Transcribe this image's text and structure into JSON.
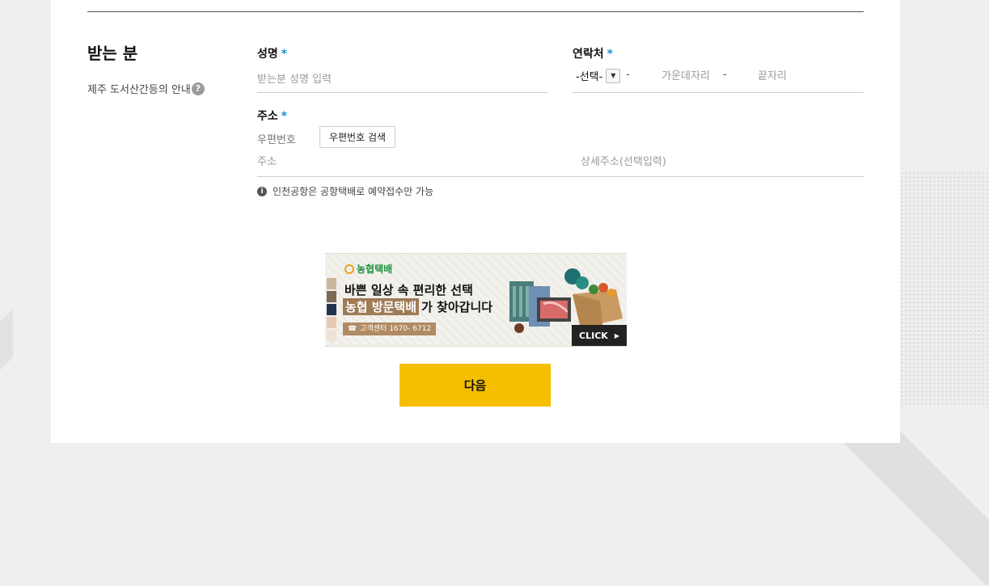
{
  "section": {
    "title": "받는 분",
    "jeju_note": "제주 도서산간등의 안내",
    "help_symbol": "?"
  },
  "name_field": {
    "label": "성명",
    "required_mark": "*",
    "placeholder": "받는분 성명 입력"
  },
  "contact_field": {
    "label": "연락처",
    "required_mark": "*",
    "select_value": "-선택-",
    "dash": "-",
    "middle_placeholder": "가운데자리",
    "end_placeholder": "끝자리"
  },
  "address_field": {
    "label": "주소",
    "required_mark": "*",
    "zipcode_label": "우편번호",
    "zipcode_button": "우편번호 검색",
    "address_placeholder": "주소",
    "detail_placeholder": "상세주소(선택입력)"
  },
  "notice": {
    "icon": "info-icon",
    "text": "인천공항은 공항택배로 예약접수만 가능"
  },
  "banner": {
    "logo_text": "농협택배",
    "line1": "바쁜 일상 속 편리한 선택",
    "highlight": "농협 방문택배",
    "line2_rest": "가 찾아갑니다",
    "call_center": "고객센터 1670- 6712",
    "click_label": "CLICK"
  },
  "next_button": {
    "label": "다음",
    "color": "#f5bf00"
  },
  "colors": {
    "accent_required": "#1a8fd1",
    "background": "#efefef",
    "panel": "#ffffff"
  }
}
